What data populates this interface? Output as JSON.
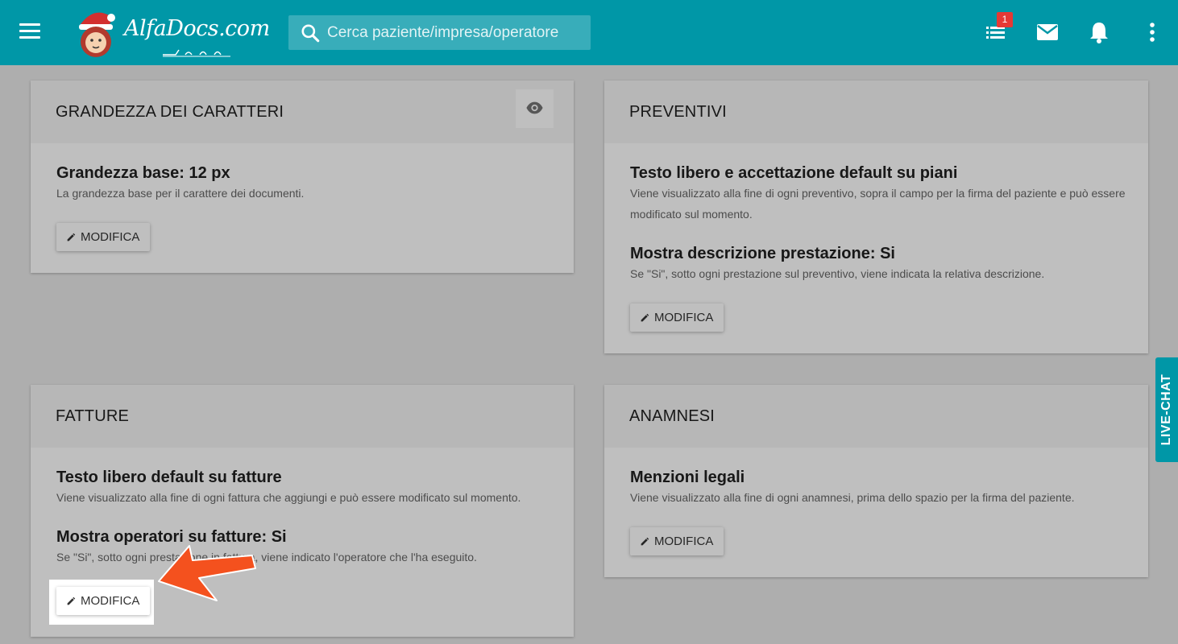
{
  "header": {
    "logo_text": "AlfaDocs.com",
    "search_placeholder": "Cerca paziente/impresa/operatore",
    "notification_count": "1"
  },
  "cards": {
    "fonts": {
      "title": "GRANDEZZA DEI CARATTERI",
      "settings": [
        {
          "title": "Grandezza base: 12 px",
          "desc": "La grandezza base per il carattere dei documenti."
        }
      ],
      "button": "MODIFICA"
    },
    "quotes": {
      "title": "PREVENTIVI",
      "settings": [
        {
          "title": "Testo libero e accettazione default su piani",
          "desc": "Viene visualizzato alla fine di ogni preventivo, sopra il campo per la firma del paziente e può essere modificato sul momento."
        },
        {
          "title": "Mostra descrizione prestazione: Si",
          "desc": "Se \"Si\", sotto ogni prestazione sul preventivo, viene indicata la relativa descrizione."
        }
      ],
      "button": "MODIFICA"
    },
    "invoices": {
      "title": "FATTURE",
      "settings": [
        {
          "title": "Testo libero default su fatture",
          "desc": "Viene visualizzato alla fine di ogni fattura che aggiungi e può essere modificato sul momento."
        },
        {
          "title": "Mostra operatori su fatture: Si",
          "desc": "Se \"Si\", sotto ogni prestazione in fattura, viene indicato l'operatore che l'ha eseguito."
        }
      ],
      "button": "MODIFICA"
    },
    "anamnesis": {
      "title": "ANAMNESI",
      "settings": [
        {
          "title": "Menzioni legali",
          "desc": "Viene visualizzato alla fine di ogni anamnesi, prima dello spazio per la firma del paziente."
        }
      ],
      "button": "MODIFICA"
    }
  },
  "livechat_label": "LIVE-CHAT",
  "colors": {
    "primary": "#0097a7",
    "badge": "#e53935",
    "arrow": "#f4511e"
  }
}
